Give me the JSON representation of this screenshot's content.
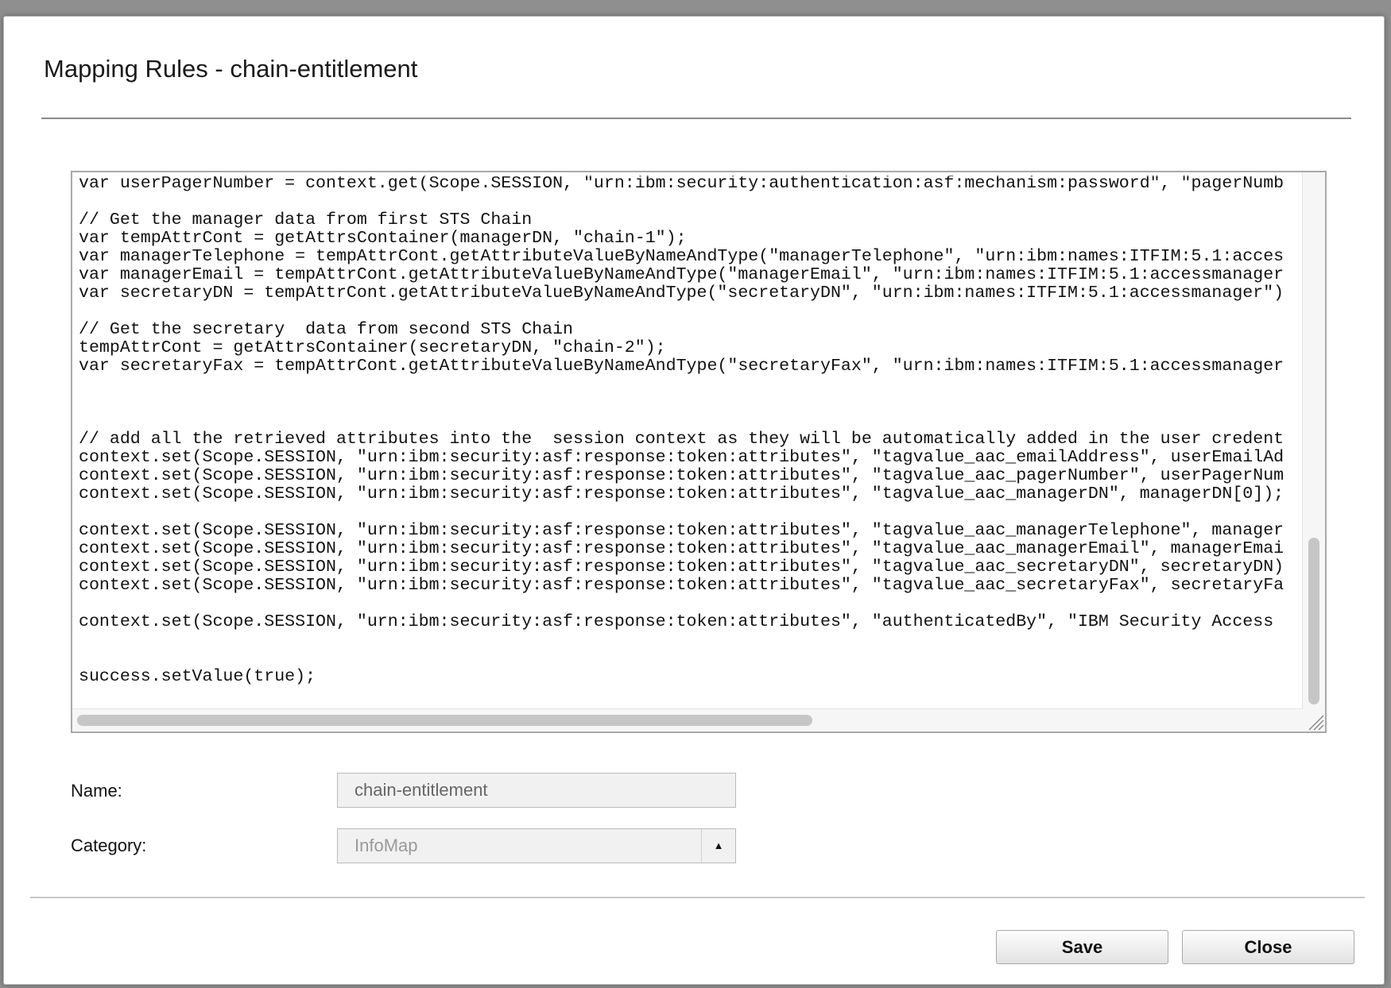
{
  "dialog": {
    "title": "Mapping Rules - chain-entitlement"
  },
  "editor": {
    "lines": [
      "var userPagerNumber = context.get(Scope.SESSION, \"urn:ibm:security:authentication:asf:mechanism:password\", \"pagerNumb",
      "",
      "// Get the manager data from first STS Chain",
      "var tempAttrCont = getAttrsContainer(managerDN, \"chain-1\");",
      "var managerTelephone = tempAttrCont.getAttributeValueByNameAndType(\"managerTelephone\", \"urn:ibm:names:ITFIM:5.1:acces",
      "var managerEmail = tempAttrCont.getAttributeValueByNameAndType(\"managerEmail\", \"urn:ibm:names:ITFIM:5.1:accessmanager",
      "var secretaryDN = tempAttrCont.getAttributeValueByNameAndType(\"secretaryDN\", \"urn:ibm:names:ITFIM:5.1:accessmanager\")",
      "",
      "// Get the secretary  data from second STS Chain",
      "tempAttrCont = getAttrsContainer(secretaryDN, \"chain-2\");",
      "var secretaryFax = tempAttrCont.getAttributeValueByNameAndType(\"secretaryFax\", \"urn:ibm:names:ITFIM:5.1:accessmanager",
      "",
      "",
      "",
      "// add all the retrieved attributes into the  session context as they will be automatically added in the user credent",
      "context.set(Scope.SESSION, \"urn:ibm:security:asf:response:token:attributes\", \"tagvalue_aac_emailAddress\", userEmailAd",
      "context.set(Scope.SESSION, \"urn:ibm:security:asf:response:token:attributes\", \"tagvalue_aac_pagerNumber\", userPagerNum",
      "context.set(Scope.SESSION, \"urn:ibm:security:asf:response:token:attributes\", \"tagvalue_aac_managerDN\", managerDN[0]);",
      "",
      "context.set(Scope.SESSION, \"urn:ibm:security:asf:response:token:attributes\", \"tagvalue_aac_managerTelephone\", manager",
      "context.set(Scope.SESSION, \"urn:ibm:security:asf:response:token:attributes\", \"tagvalue_aac_managerEmail\", managerEmai",
      "context.set(Scope.SESSION, \"urn:ibm:security:asf:response:token:attributes\", \"tagvalue_aac_secretaryDN\", secretaryDN)",
      "context.set(Scope.SESSION, \"urn:ibm:security:asf:response:token:attributes\", \"tagvalue_aac_secretaryFax\", secretaryFa",
      "",
      "context.set(Scope.SESSION, \"urn:ibm:security:asf:response:token:attributes\", \"authenticatedBy\", \"IBM Security Access",
      "",
      "",
      "success.setValue(true);"
    ]
  },
  "form": {
    "name_label": "Name:",
    "name_value": "chain-entitlement",
    "category_label": "Category:",
    "category_value": "InfoMap",
    "category_arrow_icon": "triangle-up"
  },
  "buttons": {
    "save_label": "Save",
    "close_label": "Close"
  }
}
